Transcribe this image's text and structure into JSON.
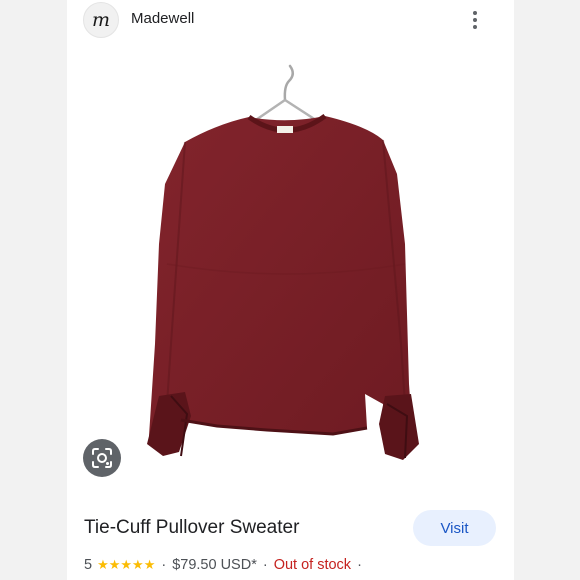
{
  "header": {
    "logo_letter": "m",
    "brand_name": "Madewell"
  },
  "product": {
    "image_subject": "Burgundy knit pullover sweater with tie cuffs on a hanger",
    "title": "Tie-Cuff Pullover Sweater",
    "visit_label": "Visit",
    "rating": "5",
    "stars": "★★★★★",
    "price": "$79.50 USD*",
    "stock": "Out of stock",
    "separator": "·"
  },
  "colors": {
    "sweater": "#7a1f27",
    "visit_bg": "#e8f0fe",
    "visit_text": "#1a56c5",
    "stock_text": "#c5221f",
    "star": "#fbbc04"
  },
  "icons": {
    "lens": "google-lens-icon",
    "menu": "more-vert-icon"
  }
}
